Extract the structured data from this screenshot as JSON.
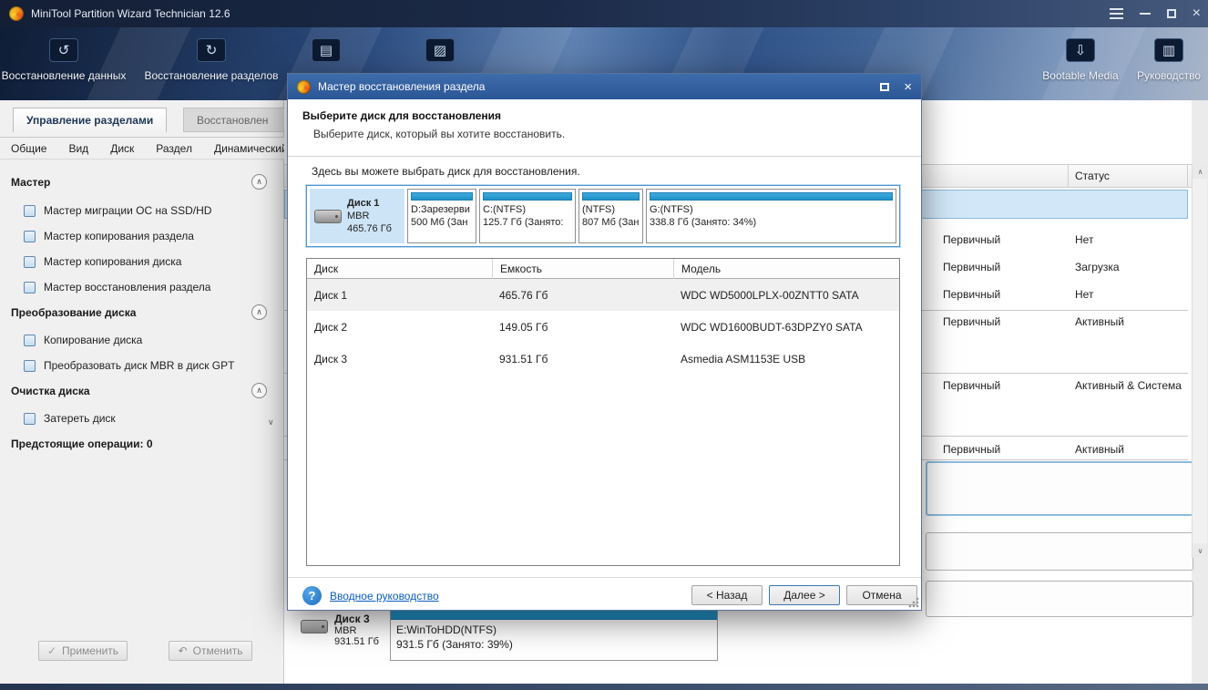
{
  "titlebar": {
    "title": "MiniTool Partition Wizard Technician 12.6"
  },
  "toolbar": {
    "data_recovery": "Восстановление данных",
    "partition_recovery": "Восстановление разделов",
    "bootable_media": "Bootable Media",
    "guide": "Руководство"
  },
  "tabs": {
    "partition_management": "Управление разделами",
    "recovery": "Восстановлен"
  },
  "menubar": {
    "items": [
      "Общие",
      "Вид",
      "Диск",
      "Раздел",
      "Динамический ди"
    ]
  },
  "sidebar": {
    "sections": [
      {
        "title": "Мастер",
        "items": [
          "Мастер миграции ОС на SSD/HD",
          "Мастер копирования раздела",
          "Мастер копирования диска",
          "Мастер восстановления раздела"
        ]
      },
      {
        "title": "Преобразование диска",
        "items": [
          "Копирование диска",
          "Преобразовать диск MBR в диск GPT"
        ]
      },
      {
        "title": "Очистка диска",
        "items": [
          "Затереть диск"
        ]
      }
    ],
    "pending_operations": "Предстоящие операции: 0",
    "apply": "Применить",
    "undo": "Отменить"
  },
  "background": {
    "status_header": "Статус",
    "rows": [
      {
        "type": "Первичный",
        "status": "Нет"
      },
      {
        "type": "Первичный",
        "status": "Загрузка"
      },
      {
        "type": "Первичный",
        "status": "Нет"
      },
      {
        "type": "Первичный",
        "status": "Активный"
      },
      {
        "type": "Первичный",
        "status": "Активный & Система"
      },
      {
        "type": "Первичный",
        "status": "Активный"
      }
    ],
    "disk3": {
      "name": "Диск 3",
      "scheme": "MBR",
      "size": "931.51 Гб",
      "partition": "E:WinToHDD(NTFS)",
      "partition_detail": "931.5 Гб (Занято: 39%)"
    }
  },
  "dialog": {
    "title": "Мастер восстановления раздела",
    "heading": "Выберите диск для восстановления",
    "subheading": "Выберите диск, который вы хотите восстановить.",
    "instruction": "Здесь вы можете выбрать диск для восстановления.",
    "disk_strip": {
      "disk_name": "Диск 1",
      "scheme": "MBR",
      "size": "465.76 Гб",
      "partitions": [
        {
          "label": "D:Зарезерви",
          "detail": "500 Мб (Зан"
        },
        {
          "label": "C:(NTFS)",
          "detail": "125.7 Гб (Занято:"
        },
        {
          "label": "(NTFS)",
          "detail": "807 Мб (Зан"
        },
        {
          "label": "G:(NTFS)",
          "detail": "338.8 Гб (Занято: 34%)"
        }
      ]
    },
    "table": {
      "columns": [
        "Диск",
        "Емкость",
        "Модель"
      ],
      "rows": [
        {
          "disk": "Диск 1",
          "capacity": "465.76 Гб",
          "model": "WDC WD5000LPLX-00ZNTT0 SATA"
        },
        {
          "disk": "Диск 2",
          "capacity": "149.05 Гб",
          "model": "WDC WD1600BUDT-63DPZY0 SATA"
        },
        {
          "disk": "Диск 3",
          "capacity": "931.51 Гб",
          "model": "Asmedia ASM1153E USB"
        }
      ]
    },
    "help_link": "Вводное руководство",
    "buttons": {
      "back": "< Назад",
      "next": "Далее >",
      "cancel": "Отмена"
    }
  },
  "colors": {
    "accent_blue": "#2f9ad2",
    "dialog_titlebar": "#2f5c9e",
    "selection": "#cfe6f7"
  }
}
